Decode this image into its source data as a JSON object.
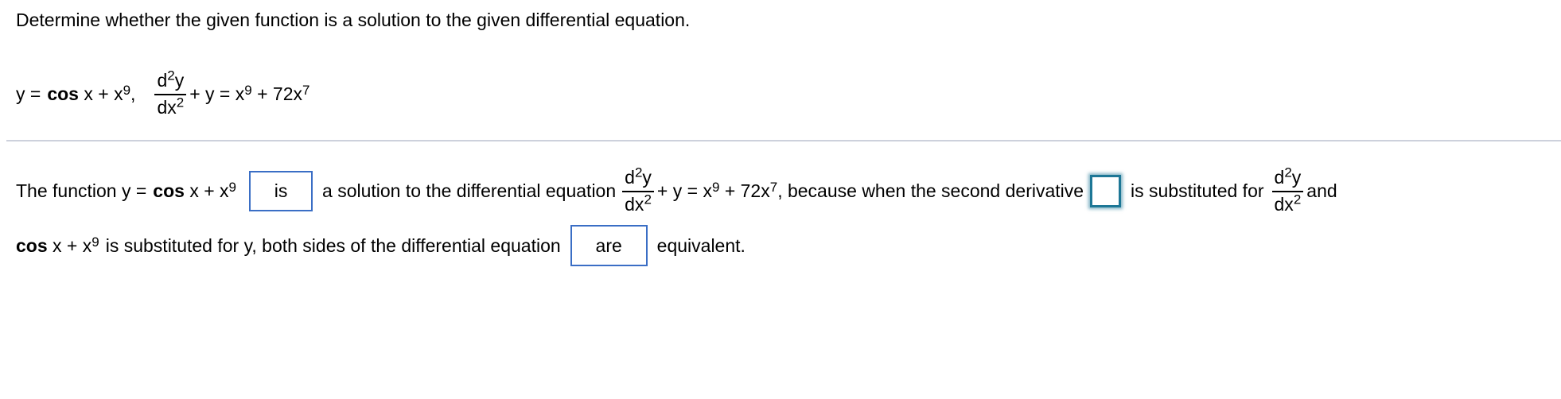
{
  "question": {
    "instruction": "Determine whether the given function is a solution to the given differential equation.",
    "given": {
      "y_label": "y =",
      "func_bold": "cos",
      "func_rest": "x + x",
      "func_exp": "9",
      "comma": ",",
      "frac_num_d": "d",
      "frac_num_sup": "2",
      "frac_num_y": "y",
      "frac_den_dx": "dx",
      "frac_den_sup": "2",
      "rhs_a": "+ y = x",
      "rhs_a_exp": "9",
      "rhs_b": "+ 72x",
      "rhs_b_exp": "7"
    }
  },
  "answer": {
    "line1": {
      "t1": "The function y =",
      "func_bold": "cos",
      "func_rest": "x + x",
      "func_exp": "9",
      "dropdown1_value": "is",
      "t2": "a solution to the differential equation",
      "frac_num_d": "d",
      "frac_num_sup": "2",
      "frac_num_y": "y",
      "frac_den_dx": "dx",
      "frac_den_sup": "2",
      "rhs_a": "+ y = x",
      "rhs_a_exp": "9",
      "rhs_b": "+ 72x",
      "rhs_b_exp": "7",
      "t3": ", because when the second derivative",
      "input_second_derivative_value": "",
      "t4": "is substituted for",
      "t5": "and"
    },
    "line2": {
      "func_bold": "cos",
      "func_rest": "x + x",
      "func_exp": "9",
      "t1": "is substituted for y, both sides of the differential equation",
      "dropdown2_value": "are",
      "t2": "equivalent."
    }
  },
  "colors": {
    "dropdown_border": "#3a6ec5",
    "active_input_border": "#1d7796",
    "separator": "#cdd1dc"
  }
}
